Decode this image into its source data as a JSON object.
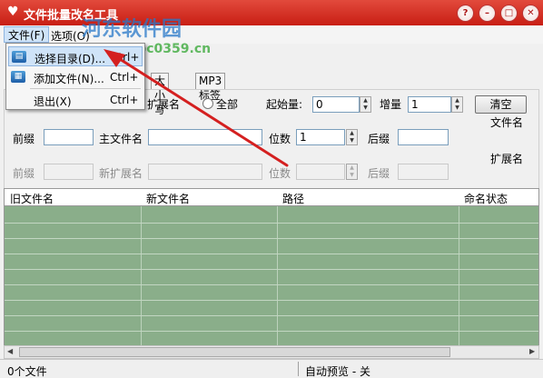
{
  "window": {
    "title": "文件批量改名工具"
  },
  "watermark": {
    "brand": "河东软件园",
    "url": "www.pc0359.cn"
  },
  "menubar": {
    "file": "文件(F)",
    "options": "选项(O)"
  },
  "file_menu": {
    "items": [
      {
        "label": "选择目录(D)...",
        "shortcut": "Ctrl+"
      },
      {
        "label": "添加文件(N)...",
        "shortcut": "Ctrl+"
      },
      {
        "label": "退出(X)",
        "shortcut": "Ctrl+"
      }
    ]
  },
  "tabs": [
    "大小写",
    "MP3标签"
  ],
  "options": {
    "ext_radio_label": "扩展名",
    "all_radio_label": "全部",
    "start_label": "起始量:",
    "start_value": "0",
    "step_label": "增量",
    "step_value": "1",
    "clear_button": "清空"
  },
  "filename_group": {
    "title": "文件名",
    "prefix_label": "前缀",
    "prefix_value": "",
    "main_label": "主文件名",
    "main_value": "",
    "digits_label": "位数",
    "digits_value": "1",
    "suffix_label": "后缀",
    "suffix_value": ""
  },
  "extension_group": {
    "title": "扩展名",
    "prefix_label": "前缀",
    "new_ext_label": "新扩展名",
    "digits_label": "位数",
    "suffix_label": "后缀"
  },
  "table": {
    "columns": [
      "旧文件名",
      "新文件名",
      "路径",
      "命名状态"
    ]
  },
  "statusbar": {
    "file_count": "0个文件",
    "auto_preview": "自动预览 - 关"
  },
  "colors": {
    "title_bar": "#d0281c",
    "grid_rows": "#8aae8a",
    "arrow": "#d42020"
  }
}
